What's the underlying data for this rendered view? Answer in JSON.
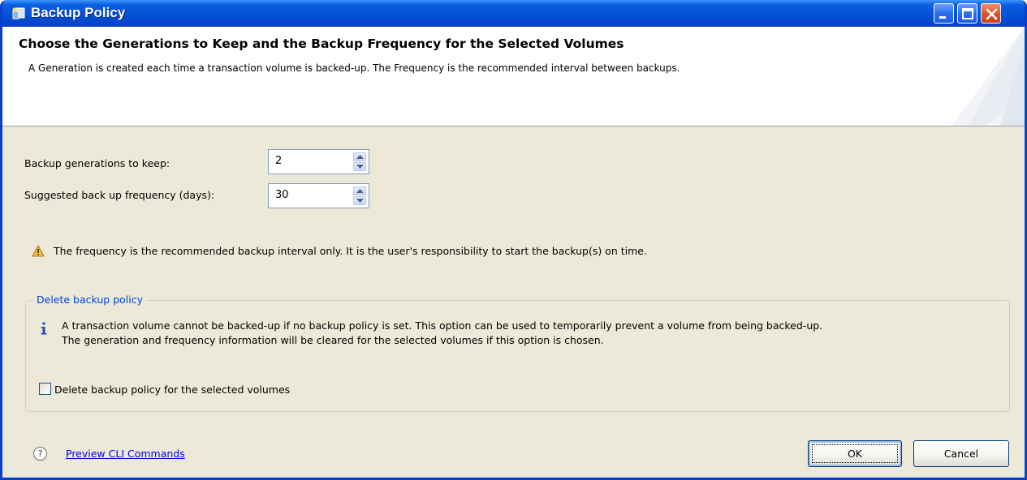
{
  "window": {
    "title": "Backup Policy",
    "controls": {
      "minimize": "minimize",
      "maximize": "maximize",
      "close": "close"
    }
  },
  "header": {
    "heading": "Choose the Generations to Keep and the Backup Frequency for the Selected Volumes",
    "description": "A Generation is created each time a transaction volume is backed-up. The Frequency is the recommended interval between backups."
  },
  "form": {
    "generations_label": "Backup generations to keep:",
    "generations_value": "2",
    "frequency_label": "Suggested back up frequency (days):",
    "frequency_value": "30"
  },
  "warning": {
    "icon": "warning-icon",
    "text": "The frequency is the recommended backup interval only. It is the user's responsibility to start the backup(s) on time."
  },
  "delete_group": {
    "legend": "Delete backup policy",
    "info_icon": "info-icon",
    "info_line1": "A transaction volume cannot be backed-up if no backup policy is set. This option can be used to temporarily prevent a volume from being backed-up.",
    "info_line2": "The generation and frequency information will be cleared for the selected volumes if this option is chosen.",
    "checkbox_label": "Delete backup policy for the selected volumes",
    "checkbox_checked": false
  },
  "footer": {
    "help_icon": "help-icon",
    "help_glyph": "?",
    "link_text": "Preview CLI Commands",
    "ok_label": "OK",
    "cancel_label": "Cancel"
  },
  "colors": {
    "titlebar": "#0453d8",
    "dialog_bg": "#ece9d8",
    "link": "#0000ee",
    "legend": "#0046d5"
  }
}
